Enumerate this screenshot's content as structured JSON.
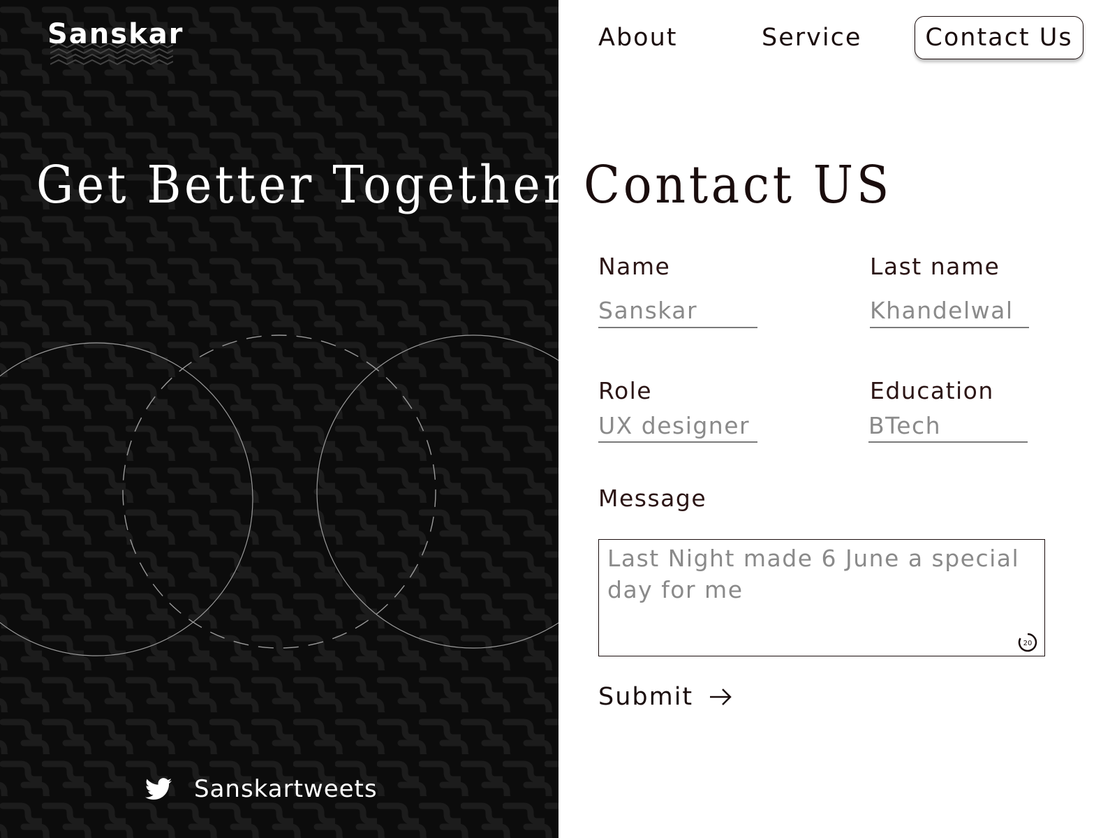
{
  "brand": {
    "logo_text": "Sanskar"
  },
  "hero": {
    "title": "Get Better Together"
  },
  "social": {
    "icon": "twitter-icon",
    "handle": "Sanskartweets"
  },
  "nav": {
    "about": "About",
    "service": "Service",
    "contact": "Contact Us"
  },
  "form": {
    "title": "Contact US",
    "name_label": "Name",
    "name_value": "Sanskar",
    "lastname_label": "Last name",
    "lastname_value": "Khandelwal",
    "role_label": "Role",
    "role_value": "UX designer",
    "education_label": "Education",
    "education_value": "BTech",
    "message_label": "Message",
    "message_value": "Last Night made 6 June a special day for me",
    "char_counter": "20",
    "submit_label": "Submit"
  },
  "colors": {
    "left_bg": "#0c0c0c",
    "accent_text": "#1a0d0d",
    "muted_text": "#8a8a8a"
  }
}
